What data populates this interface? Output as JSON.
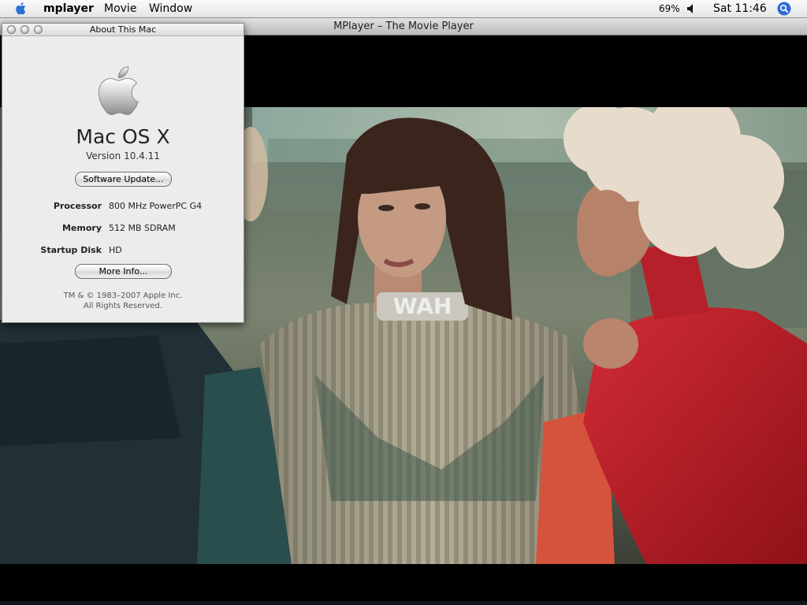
{
  "menubar": {
    "app_name": "mplayer",
    "menus": [
      "Movie",
      "Window"
    ],
    "battery": "69%",
    "clock": "Sat 11:46",
    "icons": [
      "apple-icon",
      "volume-icon",
      "spotlight-search-icon"
    ]
  },
  "player_window": {
    "title": "MPlayer – The Movie Player"
  },
  "about_window": {
    "title": "About This Mac",
    "os_name": "Mac OS X",
    "version": "Version 10.4.11",
    "software_update_label": "Software Update...",
    "specs": [
      {
        "label": "Processor",
        "value": "800 MHz PowerPC G4"
      },
      {
        "label": "Memory",
        "value": "512 MB SDRAM"
      },
      {
        "label": "Startup Disk",
        "value": "HD"
      }
    ],
    "more_info_label": "More Info...",
    "copyright_line1": "TM & © 1983–2007 Apple Inc.",
    "copyright_line2": "All Rights Reserved."
  },
  "colors": {
    "spotlight_blue": "#2f6bd8",
    "video_red": "#c8202a",
    "video_teal": "#2c4a4a"
  }
}
